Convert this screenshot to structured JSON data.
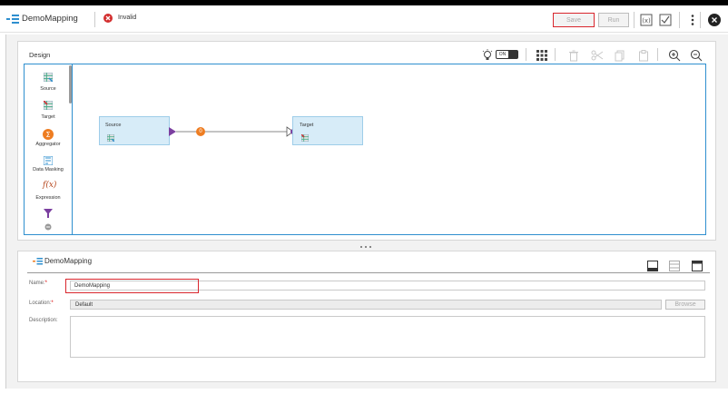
{
  "header": {
    "title": "DemoMapping",
    "status": "Invalid",
    "save_label": "Save",
    "run_label": "Run",
    "status_color": "#d32f2f"
  },
  "design": {
    "title": "Design",
    "toggle_label": "ON"
  },
  "palette": {
    "items": [
      {
        "label": "Source",
        "icon": "source-icon"
      },
      {
        "label": "Target",
        "icon": "target-icon"
      },
      {
        "label": "Aggregator",
        "icon": "aggregator-icon"
      },
      {
        "label": "Data Masking",
        "icon": "data-masking-icon"
      },
      {
        "label": "Expression",
        "icon": "expression-icon"
      }
    ]
  },
  "canvas": {
    "source_node": "Source",
    "target_node": "Target",
    "link_badge": "0"
  },
  "properties": {
    "title": "DemoMapping",
    "name_label": "Name:",
    "name_value": "DemoMapping",
    "location_label": "Location:",
    "location_value": "Default",
    "browse_label": "Browse",
    "description_label": "Description:",
    "description_value": ""
  },
  "colors": {
    "accent": "#2e8fcf",
    "highlight": "#d9262d",
    "node_fill": "#d7ecf8"
  }
}
